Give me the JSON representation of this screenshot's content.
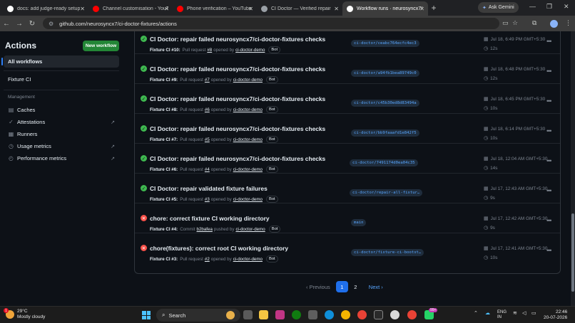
{
  "browser": {
    "tabs": [
      {
        "label": "docs: add judge-ready setup",
        "icon": "github-icon",
        "color": "#ffffff"
      },
      {
        "label": "Channel customisation - YouTube",
        "icon": "youtube-icon",
        "color": "#ff0000"
      },
      {
        "label": "Phone verification – YouTube",
        "icon": "youtube-icon",
        "color": "#ff0000"
      },
      {
        "label": "CI Doctor — Verified repair",
        "icon": "globe-icon",
        "color": "#9aa0a6"
      },
      {
        "label": "Workflow runs · neurosyncx7/",
        "icon": "github-icon",
        "color": "#ffffff"
      }
    ],
    "ask_gemini": "Ask Gemini",
    "url": "github.com/neurosyncx7/ci-doctor-fixtures/actions"
  },
  "sidebar": {
    "title": "Actions",
    "new_workflow": "New workflow",
    "all_workflows": "All workflows",
    "fixture_ci": "Fixture CI",
    "management_heading": "Management",
    "management": [
      {
        "label": "Caches",
        "icon": "cache-icon",
        "external": false
      },
      {
        "label": "Attestations",
        "icon": "attestation-icon",
        "external": true
      },
      {
        "label": "Runners",
        "icon": "runner-icon",
        "external": false
      },
      {
        "label": "Usage metrics",
        "icon": "usage-icon",
        "external": true
      },
      {
        "label": "Performance metrics",
        "icon": "performance-icon",
        "external": true
      }
    ]
  },
  "runs": [
    {
      "status": "success",
      "title": "CI Doctor: repair failed neurosyncx7/ci-doctor-fixtures checks",
      "workflow": "Fixture CI #10:",
      "event": "Pull request",
      "ref": "#8",
      "verb": "opened by",
      "actor": "ci-doctor-demo",
      "bot": "Bot",
      "branch": "ci-doctor/ceabc764ecfc4ec3",
      "when": "Jul 18, 6:49 PM GMT+5:30",
      "duration": "12s"
    },
    {
      "status": "success",
      "title": "CI Doctor: repair failed neurosyncx7/ci-doctor-fixtures checks",
      "workflow": "Fixture CI #9:",
      "event": "Pull request",
      "ref": "#7",
      "verb": "opened by",
      "actor": "ci-doctor-demo",
      "bot": "Bot",
      "branch": "ci-doctor/a94fb1bea89749c0",
      "when": "Jul 18, 6:48 PM GMT+5:30",
      "duration": "12s"
    },
    {
      "status": "success",
      "title": "CI Doctor: repair failed neurosyncx7/ci-doctor-fixtures checks",
      "workflow": "Fixture CI #8:",
      "event": "Pull request",
      "ref": "#6",
      "verb": "opened by",
      "actor": "ci-doctor-demo",
      "bot": "Bot",
      "branch": "ci-doctor/c45b30ed8d83494a",
      "when": "Jul 18, 6:45 PM GMT+5:30",
      "duration": "10s"
    },
    {
      "status": "success",
      "title": "CI Doctor: repair failed neurosyncx7/ci-doctor-fixtures checks",
      "workflow": "Fixture CI #7:",
      "event": "Pull request",
      "ref": "#5",
      "verb": "opened by",
      "actor": "ci-doctor-demo",
      "bot": "Bot",
      "branch": "ci-doctor/bb9faaafd1e842f5",
      "when": "Jul 18, 6:14 PM GMT+5:30",
      "duration": "10s"
    },
    {
      "status": "success",
      "title": "CI Doctor: repair failed neurosyncx7/ci-doctor-fixtures checks",
      "workflow": "Fixture CI #6:",
      "event": "Pull request",
      "ref": "#4",
      "verb": "opened by",
      "actor": "ci-doctor-demo",
      "bot": "Bot",
      "branch": "ci-doctor/7491174d0ea04c35",
      "when": "Jul 18, 12:04 AM GMT+5:30",
      "duration": "14s"
    },
    {
      "status": "success",
      "title": "CI Doctor: repair validated fixture failures",
      "workflow": "Fixture CI #5:",
      "event": "Pull request",
      "ref": "#3",
      "verb": "opened by",
      "actor": "ci-doctor-demo",
      "bot": "Bot",
      "branch": "ci-doctor/repair-all-fixtur…",
      "when": "Jul 17, 12:43 AM GMT+5:30",
      "duration": "9s"
    },
    {
      "status": "failure",
      "title": "chore: correct fixture CI working directory",
      "workflow": "Fixture CI #4:",
      "event": "Commit",
      "ref": "b2bafea",
      "verb": "pushed by",
      "actor": "ci-doctor-demo",
      "bot": "Bot",
      "branch": "main",
      "when": "Jul 17, 12:42 AM GMT+5:30",
      "duration": "9s"
    },
    {
      "status": "failure",
      "title": "chore(fixtures): correct root CI working directory",
      "workflow": "Fixture CI #3:",
      "event": "Pull request",
      "ref": "#2",
      "verb": "opened by",
      "actor": "ci-doctor-demo",
      "bot": "Bot",
      "branch": "ci-doctor/fixture-ci-bootst…",
      "when": "Jul 17, 12:41 AM GMT+5:30",
      "duration": "10s"
    }
  ],
  "pagination": {
    "previous": "Previous",
    "pages": [
      "1",
      "2"
    ],
    "current": "1",
    "next": "Next"
  },
  "taskbar": {
    "temp": "29°C",
    "weather": "Mostly cloudy",
    "search": "Search",
    "lang1": "ENG",
    "lang2": "IN",
    "time": "22:46",
    "date": "20-07-2026",
    "notif_badge": "99+",
    "weather_badge": "1"
  },
  "colors": {
    "accent": "#2f81f7",
    "success": "#3fb950",
    "failure": "#f85149",
    "new_button": "#238636"
  }
}
